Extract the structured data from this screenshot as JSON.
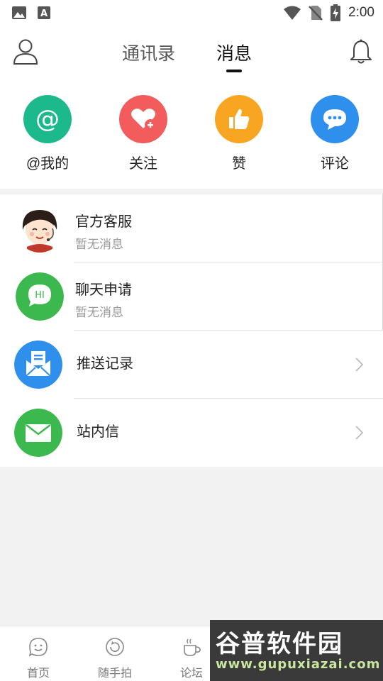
{
  "status_bar": {
    "time": "2:00"
  },
  "nav": {
    "tabs": [
      {
        "label": "通讯录"
      },
      {
        "label": "消息"
      }
    ],
    "active_tab": "消息"
  },
  "quick_actions": [
    {
      "label": "@我的",
      "icon": "at-icon",
      "color": "#1bb98c"
    },
    {
      "label": "关注",
      "icon": "heart-plus-icon",
      "color": "#f25c5c"
    },
    {
      "label": "赞",
      "icon": "thumbs-up-icon",
      "color": "#f8a622"
    },
    {
      "label": "评论",
      "icon": "comment-icon",
      "color": "#2f8fec"
    }
  ],
  "conversations": [
    {
      "title": "官方客服",
      "subtitle": "暂无消息",
      "icon": "customer-service-avatar"
    },
    {
      "title": "聊天申请",
      "subtitle": "暂无消息",
      "icon": "hi-chat-icon",
      "color": "#3bb84e"
    }
  ],
  "entries": [
    {
      "title": "推送记录",
      "icon": "push-record-icon",
      "color": "#2f8fec"
    },
    {
      "title": "站内信",
      "icon": "mail-icon",
      "color": "#3bb84e"
    }
  ],
  "bottom_nav": [
    {
      "label": "首页",
      "icon": "smile-bubble-icon"
    },
    {
      "label": "随手拍",
      "icon": "camera-refresh-icon"
    },
    {
      "label": "论坛",
      "icon": "coffee-cup-icon"
    }
  ],
  "watermark": {
    "main": "谷普软件园",
    "url": "www.gupuxiazai.com"
  }
}
